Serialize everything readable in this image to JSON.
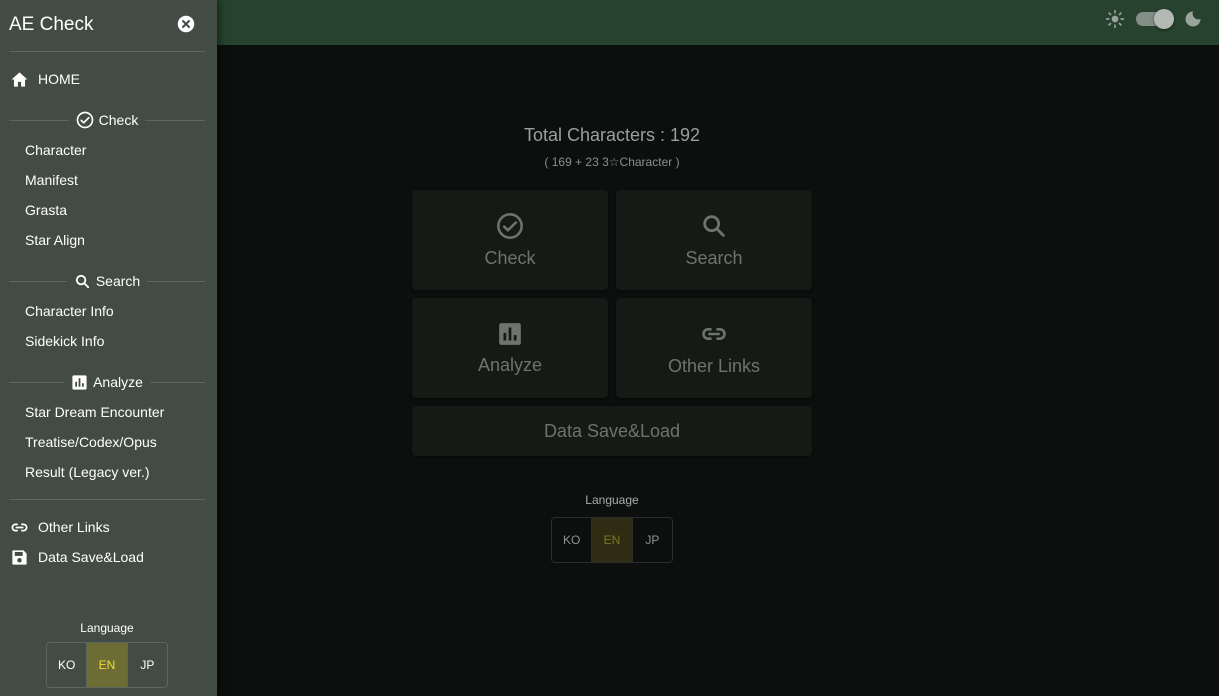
{
  "app": {
    "title": "AE Check"
  },
  "drawer": {
    "home": "HOME",
    "sections": {
      "check": {
        "label": "Check",
        "items": [
          "Character",
          "Manifest",
          "Grasta",
          "Star Align"
        ]
      },
      "search": {
        "label": "Search",
        "items": [
          "Character Info",
          "Sidekick Info"
        ]
      },
      "analyze": {
        "label": "Analyze",
        "items": [
          "Star Dream Encounter",
          "Treatise/Codex/Opus",
          "Result (Legacy ver.)"
        ]
      }
    },
    "other_links": "Other Links",
    "data_save_load": "Data Save&Load",
    "language": {
      "title": "Language",
      "options": [
        "KO",
        "EN",
        "JP"
      ],
      "selected": "EN"
    }
  },
  "main": {
    "total": "Total Characters : 192",
    "total_sub": "( 169 + 23 3☆Character )",
    "cards": {
      "check": "Check",
      "search": "Search",
      "analyze": "Analyze",
      "other_links": "Other Links",
      "data_save_load": "Data Save&Load"
    },
    "language": {
      "title": "Language",
      "options": [
        "KO",
        "EN",
        "JP"
      ],
      "selected": "EN"
    }
  },
  "theme": {
    "mode": "dark"
  },
  "colors": {
    "appbar": "#27432f",
    "drawer": "#434b45",
    "background": "#0c0f0d",
    "card": "#151a17",
    "language_active": "#f2d83a"
  }
}
